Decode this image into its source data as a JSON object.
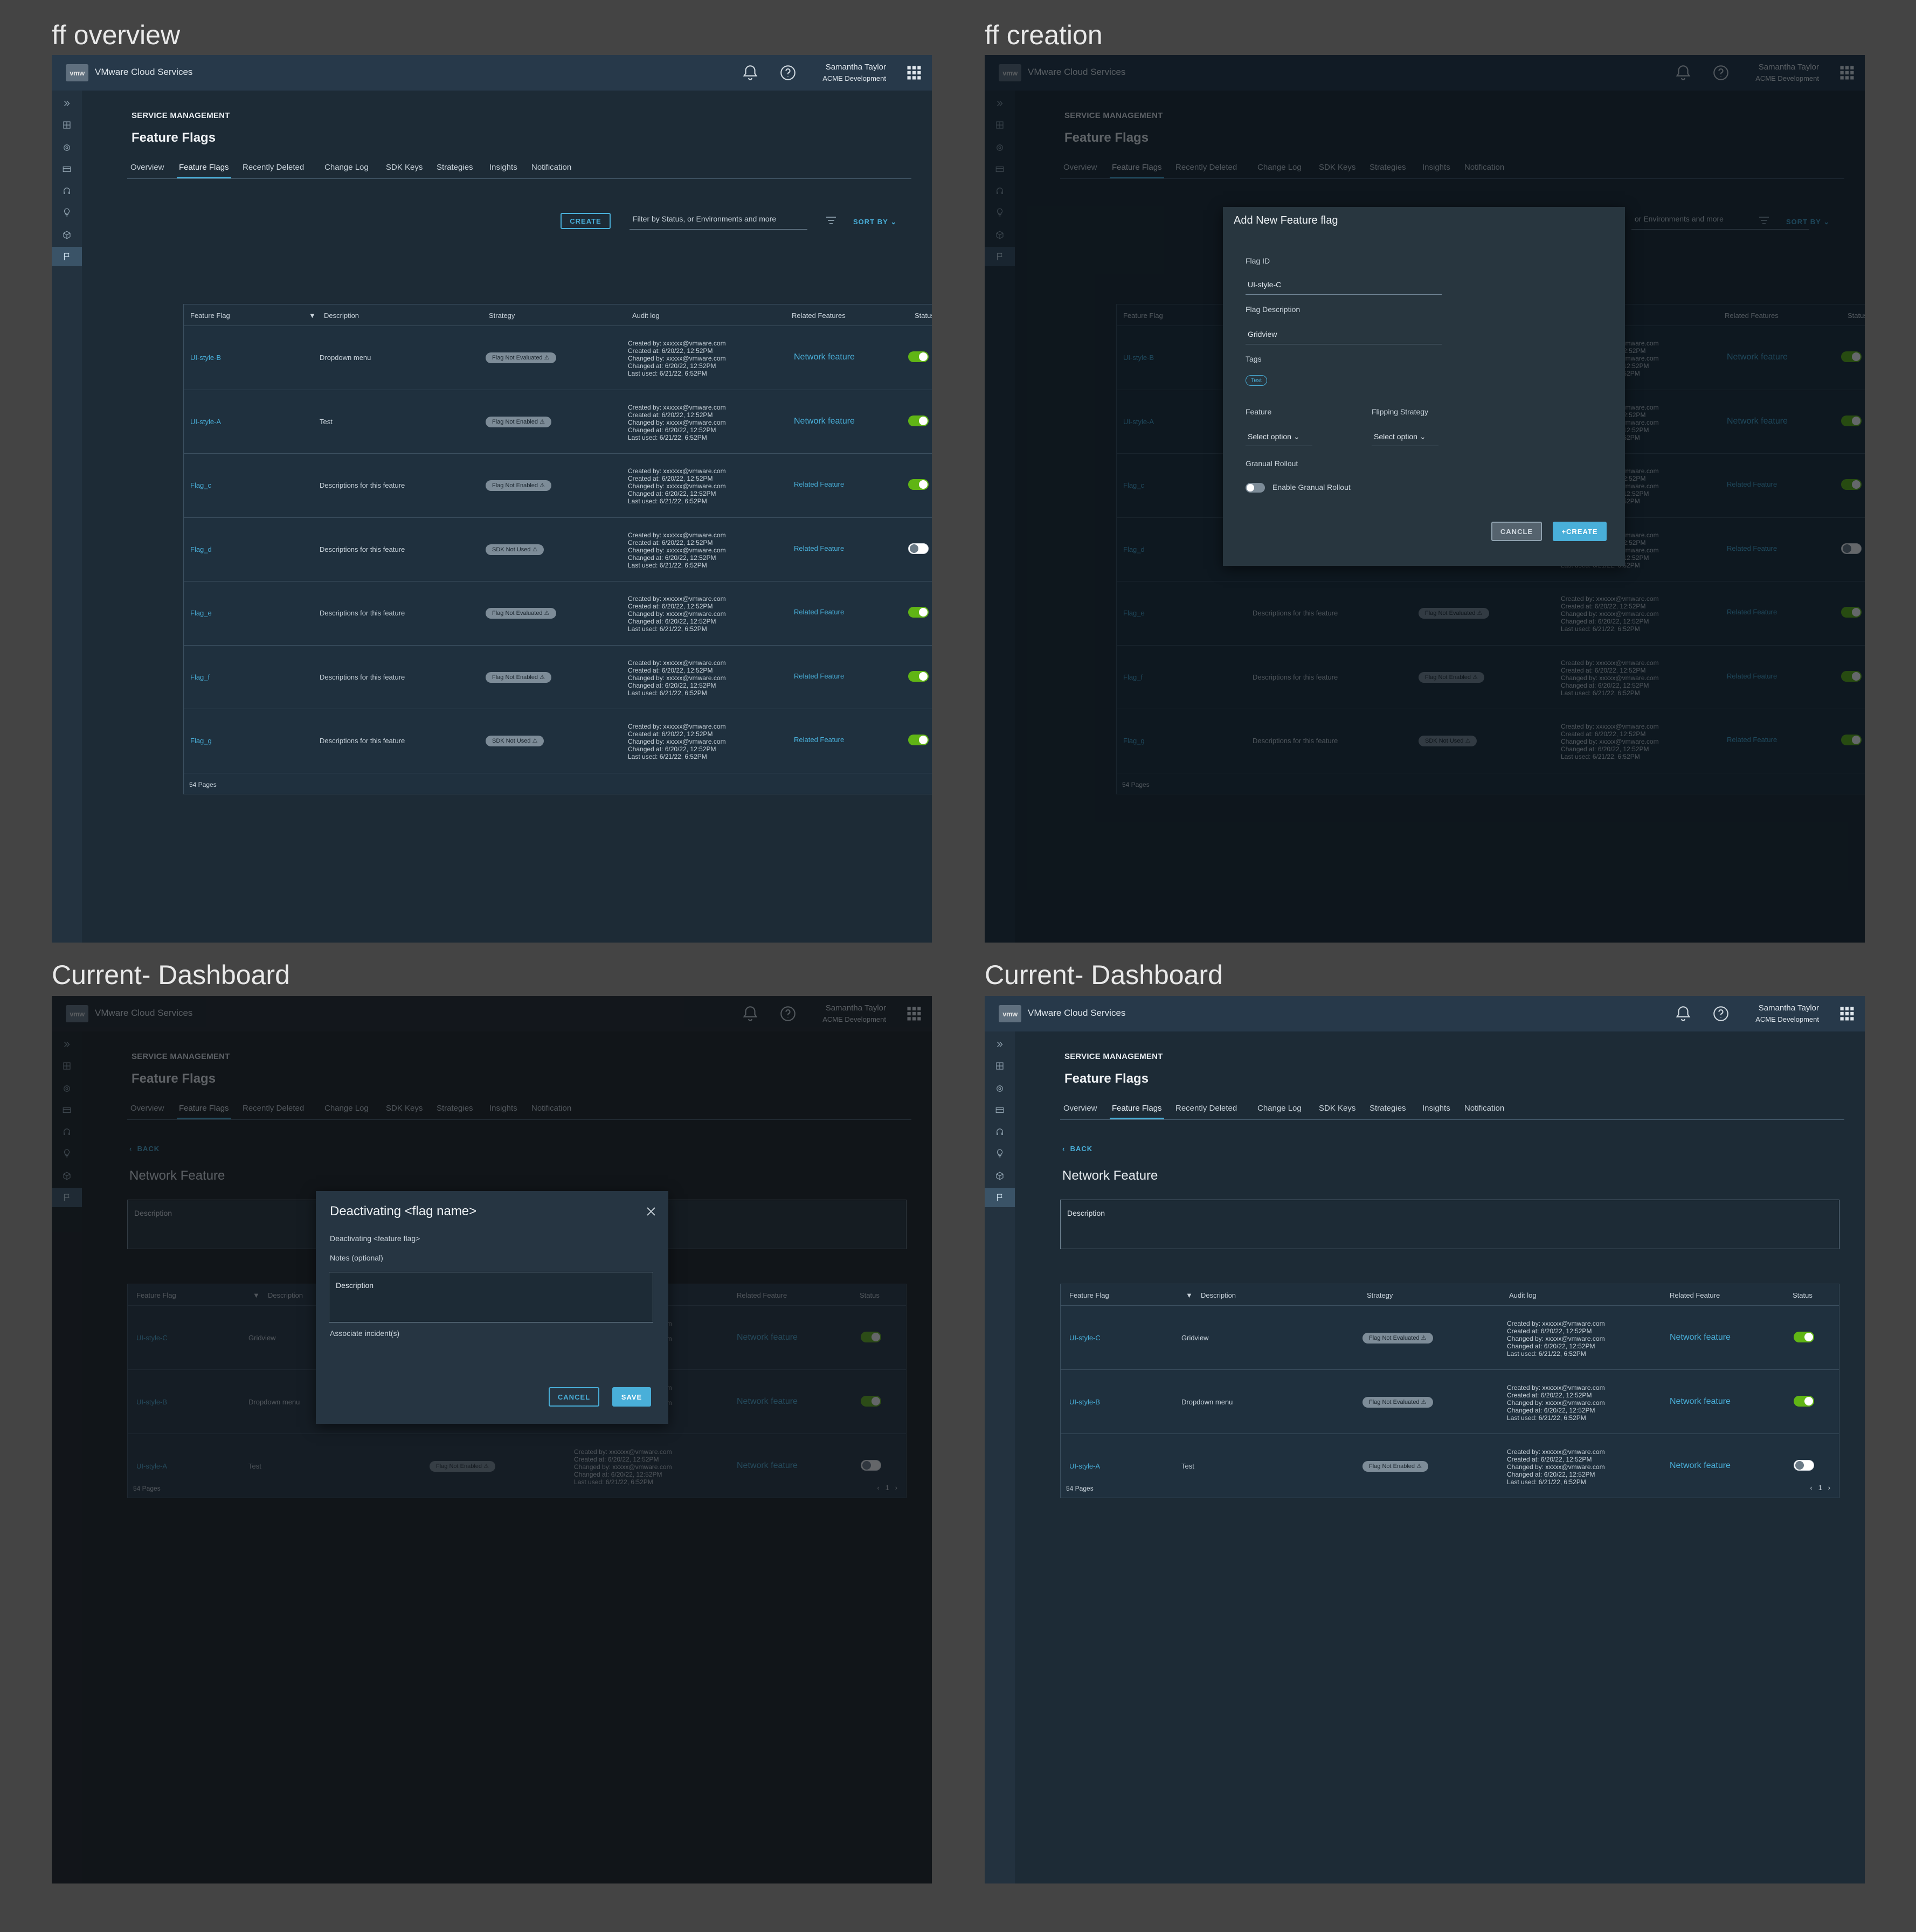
{
  "sections": {
    "s1": "ff overview",
    "s2": "ff creation",
    "s3": "Current- Dashboard",
    "s4": "Current- Dashboard"
  },
  "header": {
    "logo": "vmw",
    "app_title": "VMware Cloud Services",
    "user_name": "Samantha Taylor",
    "org": "ACME Development"
  },
  "service": "SERVICE MANAGEMENT",
  "page_title": "Feature Flags",
  "tabs": [
    "Overview",
    "Feature Flags",
    "Recently Deleted",
    "Change Log",
    "SDK Keys",
    "Strategies",
    "Insights",
    "Notification"
  ],
  "toolbar": {
    "create": "CREATE",
    "filter_placeholder": "Filter by Status, or Environments and more",
    "filter_placeholder_short": "or Environments and more",
    "sort": "SORT BY"
  },
  "table": {
    "headers": [
      "Feature Flag",
      "Description",
      "Strategy",
      "Audit log",
      "Related Features",
      "Status"
    ],
    "headers_nf": [
      "Feature Flag",
      "Description",
      "Strategy",
      "Audit log",
      "Related Feature",
      "Status"
    ],
    "audit": [
      "Created by: xxxxxx@vmware.com",
      "Created at: 6/20/22, 12:52PM",
      "Changed by: xxxxx@vmware.com",
      "Changed at: 6/20/22, 12:52PM",
      "Last used: 6/21/22, 6:52PM"
    ],
    "rows": [
      {
        "flag": "UI-style-B",
        "desc": "Dropdown menu",
        "strategy": "Flag Not Evaluated",
        "related": "Network feature",
        "status": "ON"
      },
      {
        "flag": "UI-style-A",
        "desc": "Test",
        "strategy": "Flag Not Enabled",
        "related": "Network feature",
        "status": "ON"
      },
      {
        "flag": "Flag_c",
        "desc": "Descriptions for this feature",
        "strategy": "Flag Not Enabled",
        "related": "Related Feature",
        "status": "ON"
      },
      {
        "flag": "Flag_d",
        "desc": "Descriptions for this feature",
        "strategy": "SDK Not Used",
        "related": "Related Feature",
        "status": "OFF"
      },
      {
        "flag": "Flag_e",
        "desc": "Descriptions for this feature",
        "strategy": "Flag Not Evaluated",
        "related": "Related Feature",
        "status": "ON"
      },
      {
        "flag": "Flag_f",
        "desc": "Descriptions for this feature",
        "strategy": "Flag Not Enabled",
        "related": "Related Feature",
        "status": "ON"
      },
      {
        "flag": "Flag_g",
        "desc": "Descriptions for this feature",
        "strategy": "SDK Not Used",
        "related": "Related Feature",
        "status": "ON"
      }
    ],
    "nf_rows": [
      {
        "flag": "UI-style-C",
        "desc": "Gridview",
        "strategy": "Flag Not Evaluated",
        "related": "Network feature"
      },
      {
        "flag": "UI-style-B",
        "desc": "Dropdown menu",
        "strategy": "Flag Not Evaluated",
        "related": "Network feature"
      },
      {
        "flag": "UI-style-A",
        "desc": "Test",
        "strategy": "Flag Not Enabled",
        "related": "Network feature"
      }
    ],
    "pages": "54 Pages",
    "page_num": "1"
  },
  "create_modal": {
    "title": "Add New Feature flag",
    "flag_id_label": "Flag ID",
    "flag_id_value": "UI-style-C",
    "desc_label": "Flag Description",
    "desc_value": "Gridview",
    "tags_label": "Tags",
    "tag": "Test",
    "feature_label": "Feature",
    "strategy_label": "Flipping Strategy",
    "select_option": "Select option",
    "rollout_label": "Granual Rollout",
    "rollout_toggle": "Enable Granual Rollout",
    "cancel": "CANCLE",
    "create": "+CREATE",
    "bg_audit_last": "Last used: 6/21/22, 6:52PM"
  },
  "network_feature": {
    "back": "BACK",
    "title": "Network Feature",
    "description": "Description"
  },
  "deactivate_modal": {
    "title": "Deactivating <flag name>",
    "subtitle": "Deactivating <feature flag>",
    "notes_label": "Notes (optional)",
    "notes_placeholder": "Description",
    "incidents_label": "Associate incident(s)",
    "cancel": "CANCEL",
    "save": "SAVE"
  }
}
